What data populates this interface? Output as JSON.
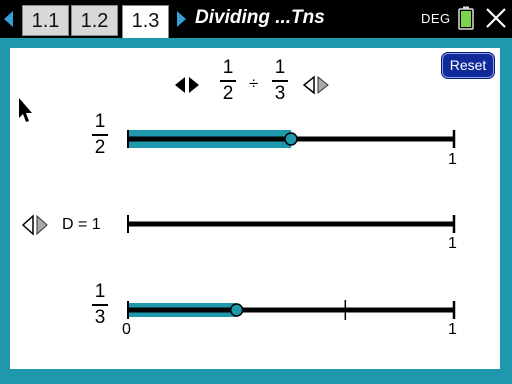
{
  "tabs": [
    {
      "label": "1.1"
    },
    {
      "label": "1.2"
    },
    {
      "label": "1.3"
    }
  ],
  "document_title": "Dividing ...Tns",
  "status": {
    "angle_mode": "DEG"
  },
  "canvas": {
    "reset_label": "Reset",
    "expression": {
      "dividend": {
        "numerator": "1",
        "denominator": "2"
      },
      "operator": "÷",
      "divisor": {
        "numerator": "1",
        "denominator": "3"
      }
    },
    "lines": [
      {
        "id": "dividend",
        "label": {
          "numerator": "1",
          "denominator": "2"
        },
        "value": 0.5,
        "end_label": "1"
      },
      {
        "id": "d",
        "label_text": "D = 1",
        "end_label": "1"
      },
      {
        "id": "divisor",
        "label": {
          "numerator": "1",
          "denominator": "3"
        },
        "value": 0.3333,
        "start_label": "0",
        "end_label": "1"
      }
    ]
  },
  "colors": {
    "frame": "#1f98ae",
    "shaded": "#1f98ae",
    "reset_button": "#102a9a",
    "tab_arrow": "#3a9fd8",
    "battery": "#7cd44a"
  }
}
